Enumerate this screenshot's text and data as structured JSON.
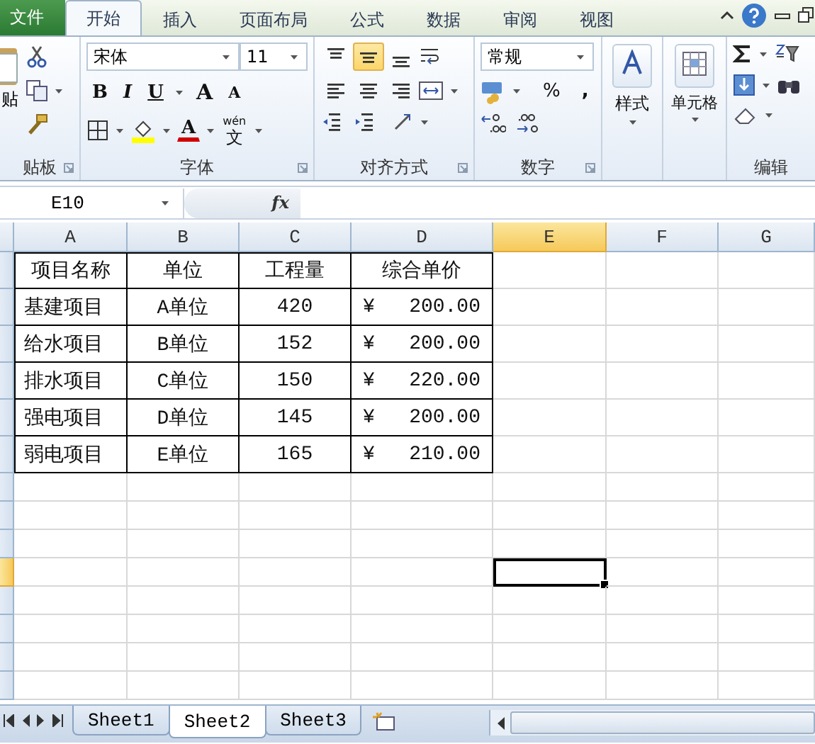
{
  "tabs": [
    {
      "label": "文件",
      "kind": "file",
      "selected": false
    },
    {
      "label": "开始",
      "kind": "tab",
      "selected": true
    },
    {
      "label": "插入",
      "kind": "tab",
      "selected": false
    },
    {
      "label": "页面布局",
      "kind": "tab",
      "selected": false
    },
    {
      "label": "公式",
      "kind": "tab",
      "selected": false
    },
    {
      "label": "数据",
      "kind": "tab",
      "selected": false
    },
    {
      "label": "审阅",
      "kind": "tab",
      "selected": false
    },
    {
      "label": "视图",
      "kind": "tab",
      "selected": false
    }
  ],
  "ribbon": {
    "clipboard": {
      "paste_label": "贴",
      "group_label": "贴板"
    },
    "font": {
      "font_name": "宋体",
      "font_size": "11",
      "style_buttons": [
        {
          "kind": "bold",
          "label": "B"
        },
        {
          "kind": "italic",
          "label": "I"
        },
        {
          "kind": "underline",
          "label": "U"
        }
      ],
      "grow_label": "A",
      "shrink_label": "A",
      "font_color_label": "A",
      "phonetic_label": "wén",
      "phonetic_char": "文",
      "group_label": "字体"
    },
    "alignment": {
      "buttons": [
        {
          "kind": "top",
          "selected": false
        },
        {
          "kind": "middle",
          "selected": true
        },
        {
          "kind": "bottom",
          "selected": false
        },
        {
          "kind": "left",
          "selected": false
        },
        {
          "kind": "center",
          "selected": false
        },
        {
          "kind": "right",
          "selected": false
        }
      ],
      "group_label": "对齐方式"
    },
    "number": {
      "format": "常规",
      "percent": "%",
      "comma": ",",
      "group_label": "数字"
    },
    "styles": {
      "label": "样式"
    },
    "cells": {
      "label": "单元格"
    },
    "editing": {
      "group_label": "编辑"
    }
  },
  "name_box": "E10",
  "insert_function": "fx",
  "columns": [
    {
      "label": "A",
      "selected": false
    },
    {
      "label": "B",
      "selected": false
    },
    {
      "label": "C",
      "selected": false
    },
    {
      "label": "D",
      "selected": false
    },
    {
      "label": "E",
      "selected": true
    },
    {
      "label": "F",
      "selected": false
    },
    {
      "label": "G",
      "selected": false
    }
  ],
  "row_headers": [
    {
      "selected": false
    },
    {
      "selected": false
    },
    {
      "selected": false
    },
    {
      "selected": false
    },
    {
      "selected": false
    },
    {
      "selected": false
    },
    {
      "selected": false
    },
    {
      "selected": false
    },
    {
      "selected": false
    },
    {
      "selected": true
    },
    {
      "selected": false
    },
    {
      "selected": false
    },
    {
      "selected": false
    },
    {
      "selected": false
    }
  ],
  "table": {
    "header": [
      "项目名称",
      "单位",
      "工程量",
      "综合单价"
    ],
    "rows": [
      {
        "name": "基建项目",
        "unit": "A单位",
        "quantity": "420",
        "currency": "¥",
        "price": "200.00"
      },
      {
        "name": "给水项目",
        "unit": "B单位",
        "quantity": "152",
        "currency": "¥",
        "price": "200.00"
      },
      {
        "name": "排水项目",
        "unit": "C单位",
        "quantity": "150",
        "currency": "¥",
        "price": "220.00"
      },
      {
        "name": "强电项目",
        "unit": "D单位",
        "quantity": "145",
        "currency": "¥",
        "price": "200.00"
      },
      {
        "name": "弱电项目",
        "unit": "E单位",
        "quantity": "165",
        "currency": "¥",
        "price": "210.00"
      }
    ]
  },
  "sheet_tabs": [
    {
      "label": "Sheet1",
      "selected": false
    },
    {
      "label": "Sheet2",
      "selected": true
    },
    {
      "label": "Sheet3",
      "selected": false
    }
  ]
}
